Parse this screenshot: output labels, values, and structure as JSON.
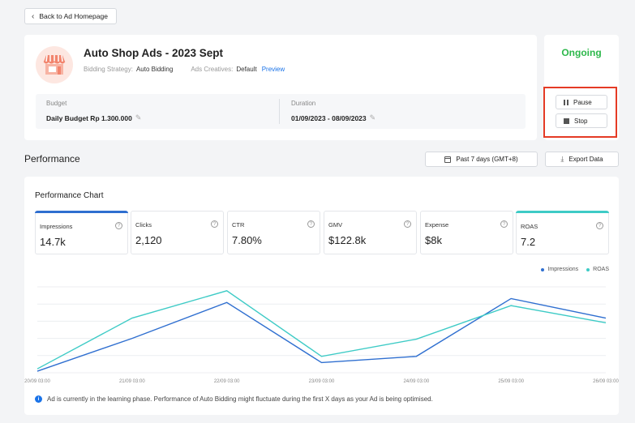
{
  "nav": {
    "back_label": "Back to Ad Homepage"
  },
  "ad": {
    "title": "Auto Shop Ads - 2023 Sept",
    "bidding_label": "Bidding Strategy:",
    "bidding_value": "Auto Bidding",
    "creatives_label": "Ads Creatives:",
    "creatives_value": "Default",
    "preview_link": "Preview",
    "budget_label": "Budget",
    "budget_value": "Daily Budget Rp 1.300.000",
    "duration_label": "Duration",
    "duration_value": "01/09/2023 - 08/09/2023"
  },
  "status": {
    "text": "Ongoing",
    "color": "#2db84b",
    "pause_label": "Pause",
    "stop_label": "Stop"
  },
  "performance": {
    "title": "Performance",
    "range_label": "Past 7 days (GMT+8)",
    "export_label": "Export Data"
  },
  "chart_panel": {
    "title": "Performance Chart",
    "metrics": [
      {
        "label": "Impressions",
        "value": "14.7k",
        "active_color": "#2f6fd0"
      },
      {
        "label": "Clicks",
        "value": "2,120"
      },
      {
        "label": "CTR",
        "value": "7.80%"
      },
      {
        "label": "GMV",
        "value": "$122.8k"
      },
      {
        "label": "Expense",
        "value": "$8k"
      },
      {
        "label": "ROAS",
        "value": "7.2",
        "active_color": "#3ecbc6"
      }
    ],
    "note": "Ad is currently in the learning phase. Performance of Auto Bidding might fluctuate during the first X days as your Ad is being optimised."
  },
  "chart_data": {
    "type": "line",
    "x": [
      "20/09 03:00",
      "21/09 03:00",
      "22/09 03:00",
      "23/09 03:00",
      "24/09 03:00",
      "25/09 03:00",
      "26/09 03:00"
    ],
    "series": [
      {
        "name": "Impressions",
        "color": "#2f6fd0",
        "values": [
          2,
          44,
          90,
          13,
          21,
          95,
          70
        ]
      },
      {
        "name": "ROAS",
        "color": "#3ecbc6",
        "values": [
          5,
          70,
          105,
          21,
          43,
          86,
          64
        ]
      }
    ],
    "ylim": [
      0,
      110
    ],
    "grid": true,
    "legend": "top-right"
  }
}
